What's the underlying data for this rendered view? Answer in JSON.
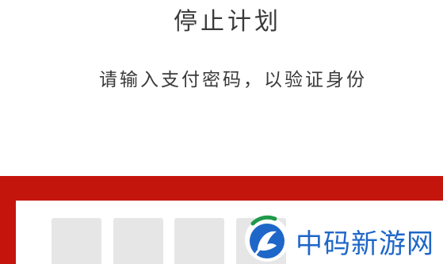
{
  "dialog": {
    "title": "停止计划",
    "subtitle": "请输入支付密码，以验证身份"
  },
  "pin_input": {
    "boxes_visible": 4,
    "colors": {
      "frame": "#c4150d",
      "box": "#e6e6e6"
    }
  },
  "watermark": {
    "logo_icon": "zhongma-logo-icon",
    "text": "中码新游网",
    "color": "#1e67c8"
  }
}
